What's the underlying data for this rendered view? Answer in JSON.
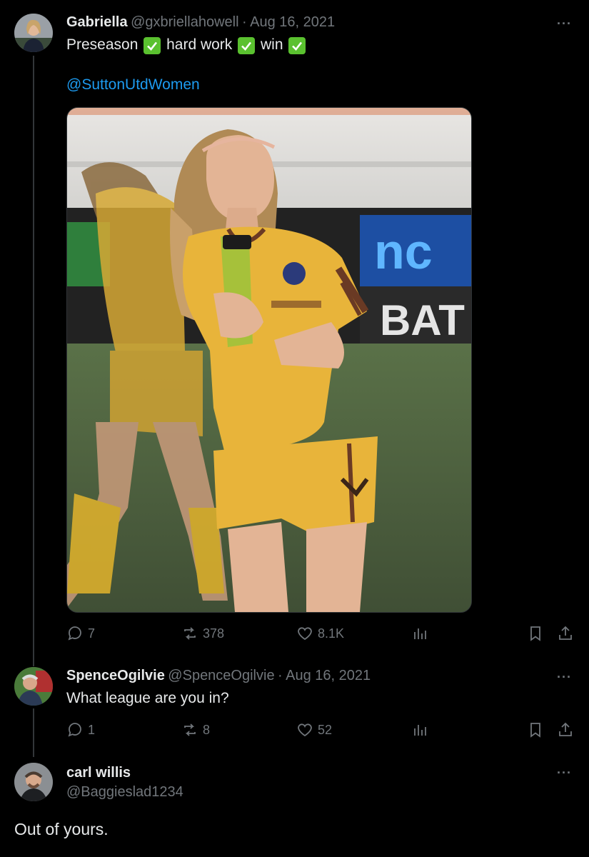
{
  "tweet": {
    "name": "Gabriella",
    "handle": "@gxbriellahowell",
    "date": "Aug 16, 2021",
    "text_parts": [
      "Preseason",
      "hard work",
      "win"
    ],
    "mention": "@SuttonUtdWomen",
    "replies": "7",
    "retweets": "378",
    "likes": "8.1K",
    "photo_icon": "soccer-player-photo"
  },
  "reply1": {
    "name": "SpenceOgilvie",
    "handle": "@SpenceOgilvie",
    "date": "Aug 16, 2021",
    "text": "What league are you in?",
    "replies": "1",
    "retweets": "8",
    "likes": "52"
  },
  "reply2": {
    "name": "carl willis",
    "handle": "@Baggieslad1234",
    "text": "Out of yours."
  },
  "ui": {
    "separator": "·",
    "more": "···"
  },
  "colors": {
    "background": "#000000",
    "accent": "#1d9bf0",
    "muted": "#71767b",
    "check": "#5ac12f",
    "kit_yellow": "#e8b43a"
  }
}
